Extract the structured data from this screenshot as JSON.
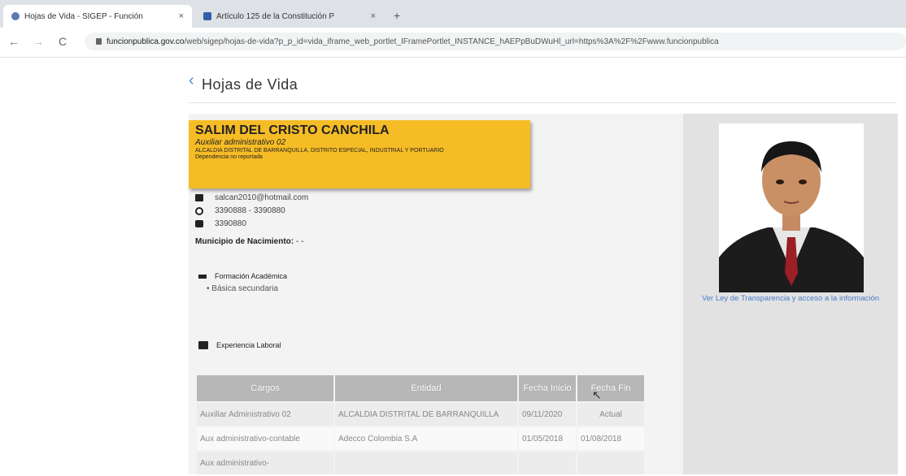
{
  "browser": {
    "tabs": [
      {
        "title": "Hojas de Vida - SIGEP - Función",
        "close": "×"
      },
      {
        "title": "Artículo 125 de la Constitución P",
        "close": "×"
      }
    ],
    "new_tab": "+",
    "url_host": "funcionpublica.gov.co",
    "url_rest": "/web/sigep/hojas-de-vida?p_p_id=vida_iframe_web_portlet_IFramePortlet_INSTANCE_hAEPpBuDWuHl_url=https%3A%2F%2Fwww.funcionpublica",
    "nav": {
      "back": "←",
      "forward": "→",
      "reload": "C"
    }
  },
  "page": {
    "back_chevron": "‹",
    "title": "Hojas de Vida"
  },
  "profile": {
    "name": "SALIM DEL CRISTO CANCHILA",
    "role": "Auxiliar administrativo 02",
    "org": "ALCALDIA DISTRITAL DE BARRANQUILLA, DISTRITO ESPECIAL, INDUSTRIAL Y PORTUARIO",
    "dependency": "Dependencia no reportada",
    "email": "salcan2010@hotmail.com",
    "whatsapp": "3390888 - 3390880",
    "phone": "3390880",
    "birthplace_label": "Municipio de Nacimiento:",
    "birthplace_value": "- -",
    "education_label": "Formación Académica",
    "education_items": [
      "Básica secundaria"
    ],
    "experience_label": "Experiencia Laboral",
    "photo_caption": "Ver Ley de Transparencia y acceso a la información",
    "icons": [
      "mail-icon",
      "whatsapp-icon",
      "phone-icon",
      "graduation-cap-icon",
      "briefcase-icon"
    ]
  },
  "experience_table": {
    "headers": [
      "Cargos",
      "Entidad",
      "Fecha Inicio",
      "Fecha Fin"
    ],
    "rows": [
      [
        "Auxiliar Administrativo 02",
        "ALCALDIA DISTRITAL DE BARRANQUILLA",
        "09/11/2020",
        "Actual"
      ],
      [
        "Aux administrativo-contable",
        "Adecco Colombia S.A",
        "01/05/2018",
        "01/08/2018"
      ],
      [
        "Aux administrativo-",
        "",
        "",
        ""
      ]
    ]
  }
}
